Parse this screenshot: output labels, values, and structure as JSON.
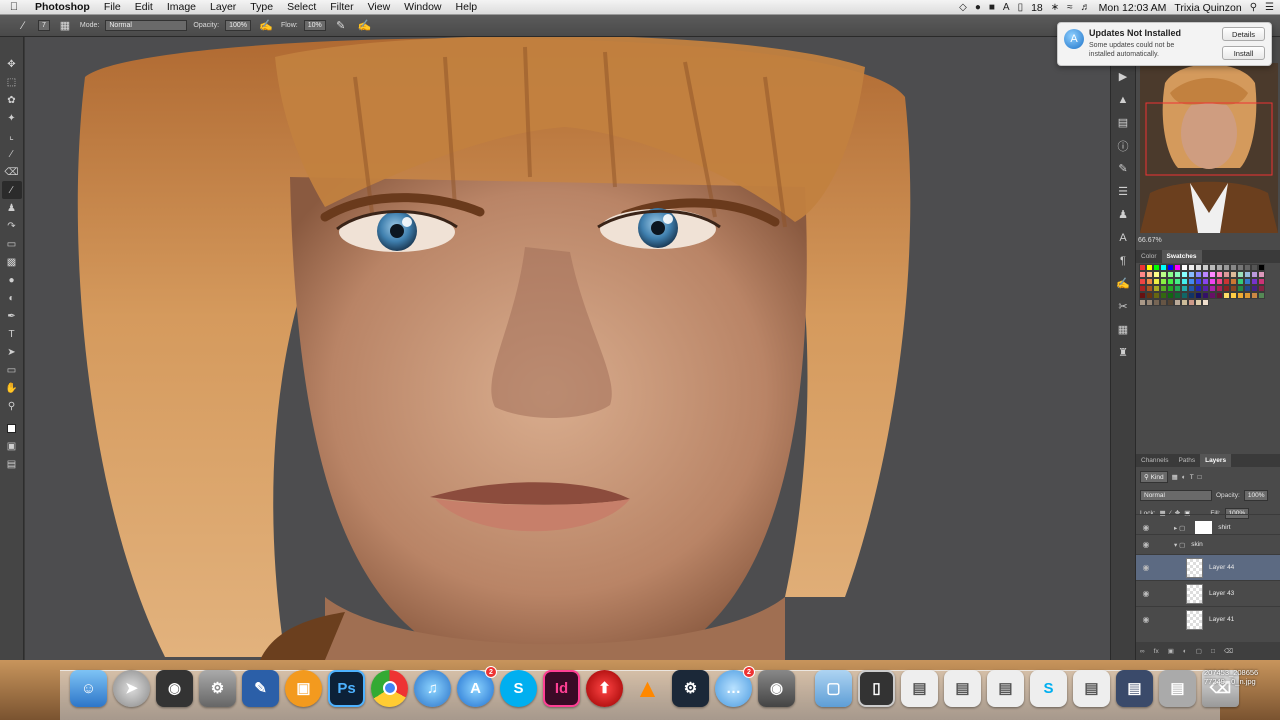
{
  "menubar": {
    "app_name": "Photoshop",
    "items": [
      "File",
      "Edit",
      "Image",
      "Layer",
      "Type",
      "Select",
      "Filter",
      "View",
      "Window",
      "Help"
    ],
    "status": {
      "battery_pct": "18",
      "time": "Mon 12:03 AM",
      "user": "Trixia Quinzon"
    }
  },
  "options_bar": {
    "brush_size": "7",
    "mode_label": "Mode:",
    "mode_value": "Normal",
    "opacity_label": "Opacity:",
    "opacity_value": "100%",
    "flow_label": "Flow:",
    "flow_value": "10%"
  },
  "notification": {
    "title": "Updates Not Installed",
    "body": "Some updates could not be installed automatically.",
    "details_label": "Details",
    "install_label": "Install"
  },
  "navigator": {
    "zoom": "66.67%"
  },
  "color_panel": {
    "tabs": [
      "Color",
      "Swatches"
    ],
    "active": "Swatches"
  },
  "layers_panel": {
    "tabs": [
      "Channels",
      "Paths",
      "Layers"
    ],
    "active": "Layers",
    "filter": "Kind",
    "blend_mode": "Normal",
    "opacity_label": "Opacity:",
    "opacity_value": "100%",
    "lock_label": "Lock:",
    "fill_label": "Fill:",
    "fill_value": "100%",
    "layers": [
      {
        "name": "shirt",
        "type": "group",
        "selected": false
      },
      {
        "name": "skin",
        "type": "group",
        "selected": false
      },
      {
        "name": "Layer 44",
        "type": "layer",
        "selected": true
      },
      {
        "name": "Layer 43",
        "type": "layer",
        "selected": false
      },
      {
        "name": "Layer 41",
        "type": "layer",
        "selected": false
      }
    ]
  },
  "dock": {
    "apps": [
      "Finder",
      "Launchpad",
      "FaceTime",
      "System Preferences",
      "Preview",
      "iBooks",
      "Photoshop",
      "Chrome",
      "iTunes",
      "App Store",
      "Skype",
      "InDesign",
      "Upload",
      "VLC",
      "Steam",
      "Messages",
      "Photo Booth",
      "Folder"
    ],
    "badges": {
      "App Store": "2",
      "Messages": "2"
    },
    "file_label_line1": "207453_208656",
    "file_label_line2": "77249...0_n.jpg"
  }
}
